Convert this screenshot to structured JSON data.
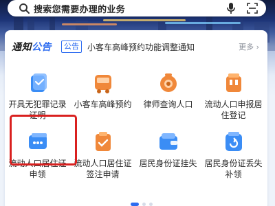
{
  "search": {
    "placeholder": "搜索您需要办理的业务"
  },
  "notice": {
    "brand_part1": "通知",
    "brand_part2": "公告",
    "tag": "公告",
    "text": "小客车高峰预约功能调整通知",
    "more": "更多 ›"
  },
  "services": [
    {
      "label": "开具无犯罪记录证明",
      "icon": "document-icon",
      "color": "#3b8df5"
    },
    {
      "label": "小客车高峰预约",
      "icon": "bus-icon",
      "color": "#f0883a"
    },
    {
      "label": "律师查询人口",
      "icon": "camera-icon",
      "color": "#f0883a"
    },
    {
      "label": "流动人口申报居住登记",
      "icon": "building-icon",
      "color": "#f0883a"
    },
    {
      "label": "流动人口居住证申领",
      "icon": "card-icon",
      "color": "#3b8df5"
    },
    {
      "label": "流动人口居住证签注申请",
      "icon": "check-doc-icon",
      "color": "#f0883a"
    },
    {
      "label": "居民身份证挂失",
      "icon": "wallet-icon",
      "color": "#3b8df5"
    },
    {
      "label": "居民身份证丢失补领",
      "icon": "refresh-icon",
      "color": "#3b8df5"
    }
  ],
  "colors": {
    "accent": "#2d6cf0",
    "highlight": "#d9201f"
  }
}
